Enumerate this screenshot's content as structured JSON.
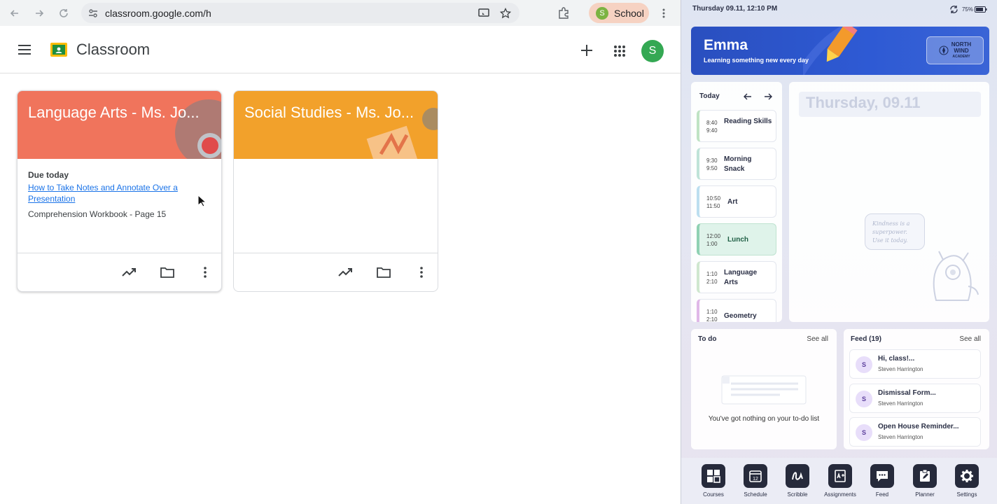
{
  "browser": {
    "url": "classroom.google.com/h",
    "profile_initial": "S",
    "profile_label": "School",
    "app_title": "Classroom",
    "user_initial": "S"
  },
  "cards": [
    {
      "title": "Language Arts - Ms. Jo...",
      "due_heading": "Due today",
      "assignment_link": "How to Take Notes and Annotate Over a Presentation",
      "assignment_2": "Comprehension Workbook - Page 15",
      "banner_color": "#f0745c"
    },
    {
      "title": "Social Studies - Ms. Jo...",
      "banner_color": "#f2a12b"
    }
  ],
  "tablet": {
    "status_time": "Thursday 09.11, 12:10 PM",
    "battery": "75%",
    "hero": {
      "name": "Emma",
      "subtitle": "Learning something new every day",
      "logo_lines": [
        "NORTH",
        "WIND",
        "ACADEMY"
      ]
    },
    "schedule": {
      "label": "Today",
      "items": [
        {
          "start": "8:40",
          "end": "9:40",
          "name": "Reading Skills",
          "color": "#bfe3c4"
        },
        {
          "start": "9:30",
          "end": "9:50",
          "name": "Morning Snack",
          "color": "#bfe3d8"
        },
        {
          "start": "10:50",
          "end": "11:50",
          "name": "Art",
          "color": "#bcdff0"
        },
        {
          "start": "12:00",
          "end": "1:00",
          "name": "Lunch",
          "color": "#8fd1b3"
        },
        {
          "start": "1:10",
          "end": "2:10",
          "name": "Language Arts",
          "color": "#cfe7cf"
        },
        {
          "start": "1:10",
          "end": "2:10",
          "name": "Geometry",
          "color": "#e0b8e8"
        }
      ]
    },
    "day_title": "Thursday, 09.11",
    "sticky_note": "Kindness is a superpower. Use it today.",
    "todo": {
      "title": "To do",
      "see_all": "See all",
      "empty": "You've got nothing on your to-do list"
    },
    "feed": {
      "title": "Feed (19)",
      "see_all": "See all",
      "items": [
        {
          "initial": "S",
          "title": "Hi, class!...",
          "author": "Steven Harrington"
        },
        {
          "initial": "S",
          "title": "Dismissal Form...",
          "author": "Steven Harrington"
        },
        {
          "initial": "S",
          "title": "Open House Reminder...",
          "author": "Steven Harrington"
        }
      ]
    },
    "dock": [
      "Courses",
      "Schedule",
      "Scribble",
      "Assignments",
      "Feed",
      "Planner",
      "Settings"
    ],
    "schedule_icon_number": "12"
  }
}
